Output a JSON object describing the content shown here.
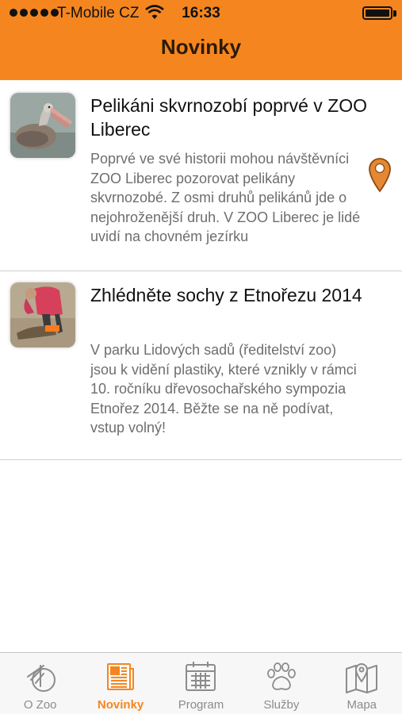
{
  "status": {
    "carrier": "T-Mobile CZ",
    "time": "16:33"
  },
  "nav": {
    "title": "Novinky"
  },
  "colors": {
    "accent": "#f5861f",
    "tab_inactive": "#8c8c8c",
    "description_text": "#6e6e6e"
  },
  "news": [
    {
      "title": "Pelikáni skvrnozobí poprvé v ZOO Liberec",
      "description": "Poprvé ve své historii mohou návštěvníci ZOO Liberec pozorovat pelikány skvrnozobé. Z osmi druhů pelikánů jde o nejohroženější druh. V ZOO Liberec je lidé uvidí na chovném jezírku",
      "thumbnail": "pelican-photo",
      "has_location": true
    },
    {
      "title": "Zhlédněte sochy z Etnořezu 2014",
      "description": "V parku Lidových sadů (ředitelství zoo) jsou k vidění plastiky, které vznikly v rámci 10. ročníku dřevosochařského sympozia Etnořez 2014. Běžte se na ně podívat, vstup volný!",
      "thumbnail": "woodcarving-photo",
      "has_location": false
    }
  ],
  "tabs": [
    {
      "label": "O Zoo",
      "icon": "zoo-logo-icon",
      "active": false
    },
    {
      "label": "Novinky",
      "icon": "newspaper-icon",
      "active": true
    },
    {
      "label": "Program",
      "icon": "calendar-icon",
      "active": false
    },
    {
      "label": "Služby",
      "icon": "paw-icon",
      "active": false
    },
    {
      "label": "Mapa",
      "icon": "map-icon",
      "active": false
    }
  ]
}
